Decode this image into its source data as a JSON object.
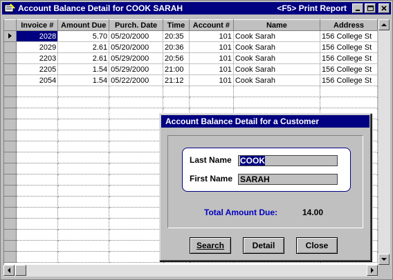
{
  "window": {
    "title": "Account Balance Detail for COOK  SARAH",
    "shortcut": "<F5>  Print Report"
  },
  "grid": {
    "columns": [
      "Invoice #",
      "Amount Due",
      "Purch. Date",
      "Time",
      "Account #",
      "Name",
      "Address"
    ],
    "rows": [
      [
        "2028",
        "5.70",
        "05/20/2000",
        "20:35",
        "101",
        "Cook Sarah",
        "156 College St"
      ],
      [
        "2029",
        "2.61",
        "05/20/2000",
        "20:36",
        "101",
        "Cook Sarah",
        "156 College St"
      ],
      [
        "2203",
        "2.61",
        "05/29/2000",
        "20:56",
        "101",
        "Cook Sarah",
        "156 College St"
      ],
      [
        "2205",
        "1.54",
        "05/29/2000",
        "21:00",
        "101",
        "Cook Sarah",
        "156 College St"
      ],
      [
        "2054",
        "1.54",
        "05/22/2000",
        "21:12",
        "101",
        "Cook Sarah",
        "156 College St"
      ]
    ]
  },
  "dialog": {
    "title": "Account Balance Detail for a Customer",
    "last_name_label": "Last Name",
    "last_name_value": "COOK",
    "first_name_label": "First Name",
    "first_name_value": "SARAH",
    "total_label": "Total Amount Due:",
    "total_value": "14.00",
    "search_label": "Search",
    "detail_label": "Detail",
    "close_label": "Close"
  },
  "colors": {
    "titlebar": "#000080",
    "total_label": "#0000c0",
    "selection": "#000080"
  }
}
